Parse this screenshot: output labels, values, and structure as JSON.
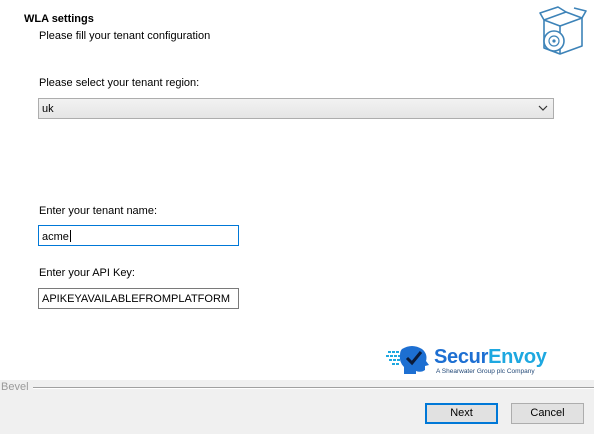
{
  "header": {
    "title": "WLA settings",
    "subtitle": "Please fill your tenant configuration",
    "icon": "installer-box-cd-icon"
  },
  "region": {
    "label": "Please select your tenant region:",
    "selected": "uk"
  },
  "tenant_name": {
    "label": "Enter your tenant name:",
    "value": "acme"
  },
  "api_key": {
    "label": "Enter your API Key:",
    "value": "APIKEYAVAILABLEFROMPLATFORM"
  },
  "logo": {
    "name_part1": "Secur",
    "name_part2": "Envoy",
    "tagline": "A Shearwater Group plc Company"
  },
  "bevel": {
    "label": "Bevel"
  },
  "buttons": {
    "next": "Next",
    "cancel": "Cancel"
  },
  "colors": {
    "focus_border": "#0078d7",
    "logo_dark": "#1d6fd2",
    "logo_light": "#1ea8e0"
  }
}
